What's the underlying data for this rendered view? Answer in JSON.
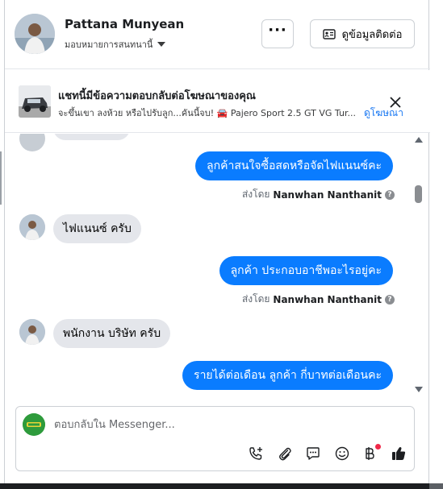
{
  "header": {
    "name": "Pattana Munyean",
    "assign_label": "มอบหมายการสนทนานี้",
    "more_label": "···",
    "contact_label": "ดูข้อมูลติดต่อ"
  },
  "ad": {
    "title": "แชทนี้มีข้อความตอบกลับต่อโฆษณาของคุณ",
    "subtitle": "จะขึ้นเขา ลงห้วย หรือไปรับลูก...คันนี้จบ! 🚘 Pajero Sport 2.5 GT VG Tur...",
    "link": "ดูโฆษณา"
  },
  "messages": [
    {
      "type": "out",
      "text": "ลูกค้าสนใจซื้อสดหรือจัดไฟแนนซ์คะ"
    },
    {
      "type": "sent_by",
      "prefix": "ส่งโดย",
      "name": "Nanwhan Nanthanit"
    },
    {
      "type": "in",
      "text": "ไฟแนนซ์ ครับ"
    },
    {
      "type": "out",
      "text": "ลูกค้า  ประกอบอาชีพอะไรอยู่คะ"
    },
    {
      "type": "sent_by",
      "prefix": "ส่งโดย",
      "name": "Nanwhan Nanthanit"
    },
    {
      "type": "in",
      "text": "พนักงาน บริษัท ครับ"
    },
    {
      "type": "out",
      "text": "รายได้ต่อเดือน  ลูกค้า  กี่บาทต่อเดือนคะ"
    }
  ],
  "composer": {
    "placeholder": "ตอบกลับใน Messenger...",
    "value": ""
  },
  "icons": {
    "call": "phone-plus-icon",
    "attach": "paperclip-icon",
    "saved_reply": "chat-bubble-icon",
    "emoji": "smiley-icon",
    "payment": "baht-icon",
    "like": "thumbs-up-icon"
  },
  "colors": {
    "outgoing_bubble": "#0a7cff",
    "incoming_bubble": "#e4e6eb",
    "link": "#1877f2",
    "notification_dot": "#f02849"
  }
}
